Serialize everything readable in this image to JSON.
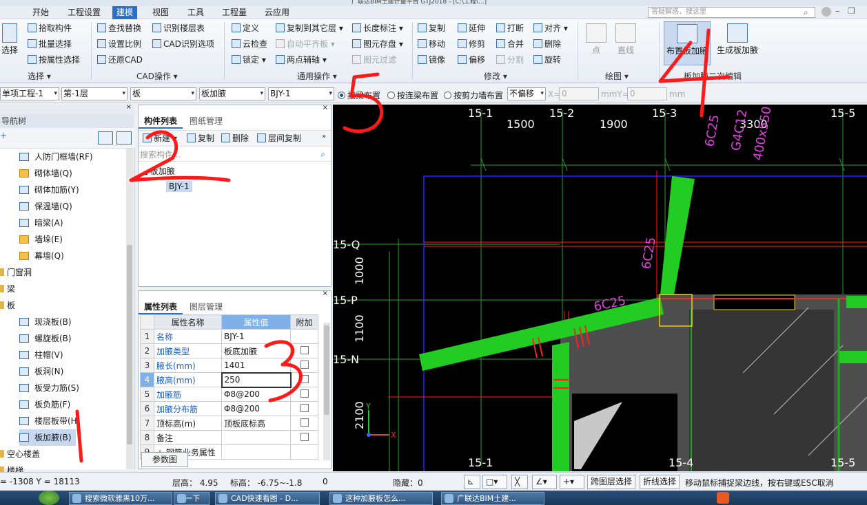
{
  "titlebar": {
    "text": "广联达BIM土建计量平台 GTJ2018 - [C:\\工程\\...]"
  },
  "menu": {
    "items": [
      "开始",
      "工程设置",
      "建模",
      "视图",
      "工具",
      "工程量",
      "云应用"
    ],
    "active_index": 2,
    "search_placeholder": "答疑解惑，搜这里"
  },
  "ribbon": {
    "select_label": "选择",
    "select_group": "选择 ▾",
    "pick": "拾取构件",
    "batch": "批量选择",
    "byprop": "按属性选择",
    "find": "查找替换",
    "setscale": "设置比例",
    "restorecad": "还原CAD",
    "recog_floor": "识别楼层表",
    "cad_opts": "CAD识别选项",
    "cad_group": "CAD操作 ▾",
    "define": "定义",
    "cloudcheck": "云检查",
    "lock": "锁定 ▾",
    "copyto": "复制到其它层 ▾",
    "autoflat": "自动平齐板 ▾",
    "twopt": "两点辅轴 ▾",
    "lenmark": "长度标注 ▾",
    "elemsave": "图元存盘 ▾",
    "elemfilter": "图元过滤",
    "common_group": "通用操作 ▾",
    "copy": "复制",
    "move": "移动",
    "mirror": "镜像",
    "extend": "延伸",
    "trim": "修剪",
    "offset": "偏移",
    "break": "打断",
    "merge": "合并",
    "split": "分割",
    "align": "对齐 ▾",
    "delete": "删除",
    "rotate": "旋转",
    "modify_group": "修改 ▾",
    "point": "点",
    "line": "直线",
    "draw_group": "绘图 ▾",
    "place_haunch": "布置板加腋",
    "gen_haunch": "生成板加腋",
    "haunch_group": "板加腋二次编辑"
  },
  "propbar": {
    "project": "单项工程-1",
    "floor": "第-1层",
    "category": "板",
    "subcategory": "板加腋",
    "element": "BJY-1",
    "opt1": "按梁布置",
    "opt2": "按连梁布置",
    "opt3": "按剪力墙布置",
    "offset": "不偏移",
    "x_label": "X=",
    "x_val": "0",
    "y_label": "mmY=",
    "y_val": "0",
    "unit": "mm"
  },
  "nav": {
    "title": "导航树",
    "items": [
      {
        "label": "人防门框墙(RF)",
        "indent": 2
      },
      {
        "label": "砌体墙(Q)",
        "indent": 2
      },
      {
        "label": "砌体加筋(Y)",
        "indent": 2
      },
      {
        "label": "保温墙(Q)",
        "indent": 2
      },
      {
        "label": "暗梁(A)",
        "indent": 2
      },
      {
        "label": "墙垛(E)",
        "indent": 2
      },
      {
        "label": "幕墙(Q)",
        "indent": 2
      },
      {
        "label": "门窗洞",
        "indent": 0
      },
      {
        "label": "梁",
        "indent": 0
      },
      {
        "label": "板",
        "indent": 0
      },
      {
        "label": "现浇板(B)",
        "indent": 2
      },
      {
        "label": "螺旋板(B)",
        "indent": 2
      },
      {
        "label": "柱帽(V)",
        "indent": 2
      },
      {
        "label": "板洞(N)",
        "indent": 2
      },
      {
        "label": "板受力筋(S)",
        "indent": 2
      },
      {
        "label": "板负筋(F)",
        "indent": 2
      },
      {
        "label": "楼层板带(H)",
        "indent": 2
      },
      {
        "label": "板加腋(B)",
        "indent": 2
      },
      {
        "label": "空心楼盖",
        "indent": 0
      },
      {
        "label": "楼梯",
        "indent": 0
      }
    ]
  },
  "complist": {
    "tab1": "构件列表",
    "tab2": "图纸管理",
    "new": "新建 ▾",
    "copy": "复制",
    "delete": "删除",
    "floorcopy": "层间复制",
    "search_placeholder": "搜索构件...",
    "folder": "板加腋",
    "item": "BJY-1"
  },
  "props": {
    "tab1": "属性列表",
    "tab2": "图层管理",
    "col_name": "属性名称",
    "col_value": "属性值",
    "col_extra": "附加",
    "rows": [
      {
        "n": "1",
        "name": "名称",
        "value": "BJY-1",
        "blue": true,
        "check": false
      },
      {
        "n": "2",
        "name": "加腋类型",
        "value": "板底加腋",
        "blue": true,
        "check": true
      },
      {
        "n": "3",
        "name": "腋长(mm)",
        "value": "1401",
        "blue": true,
        "check": true
      },
      {
        "n": "4",
        "name": "腋高(mm)",
        "value": "250",
        "blue": true,
        "check": true
      },
      {
        "n": "5",
        "name": "加腋筋",
        "value": "Φ8@200",
        "blue": true,
        "check": true
      },
      {
        "n": "6",
        "name": "加腋分布筋",
        "value": "Φ8@200",
        "blue": true,
        "check": true
      },
      {
        "n": "7",
        "name": "顶标高(m)",
        "value": "顶板底标高",
        "blue": false,
        "check": true
      },
      {
        "n": "8",
        "name": "备注",
        "value": "",
        "blue": false,
        "check": true
      },
      {
        "n": "9",
        "name": "+ 钢筋业务属性",
        "value": "",
        "blue": false,
        "check": false
      }
    ],
    "param_btn": "参数图"
  },
  "canvas": {
    "axes_top": [
      "15-1",
      "15-2",
      "15-3",
      "15-5"
    ],
    "axes_bottom": [
      "15-1",
      "15-4",
      "15-5"
    ],
    "axes_left": [
      "15-Q",
      "15-P",
      "15-N"
    ],
    "dims_top": [
      "1500",
      "1900",
      "3300"
    ],
    "dims_left": [
      "1000",
      "1100",
      "2100"
    ],
    "mag_labels": [
      "6C25",
      "6C25",
      "6C25",
      "G4C12",
      "400x550"
    ]
  },
  "status": {
    "coords": "= -1308 Y = 18113",
    "floorh": "层高：  4.95",
    "elev": "标高：  -6.75~-1.8",
    "zero": "0",
    "hidden": "隐藏：0",
    "crossfloor": "跨图层选择",
    "polyline": "折线选择",
    "hint": "移动鼠标捕捉梁边线，按右键或ESC取消"
  },
  "taskbar": {
    "items": [
      "搜索微软雅黑10万...",
      "搜一下",
      "CAD快速看图 - D...",
      "这种加腋板怎么...",
      "广联达BIM土建..."
    ]
  },
  "annotations": {
    "color": "#ff1a1a",
    "marks": [
      "1",
      "2",
      "3",
      "4",
      "5"
    ]
  }
}
